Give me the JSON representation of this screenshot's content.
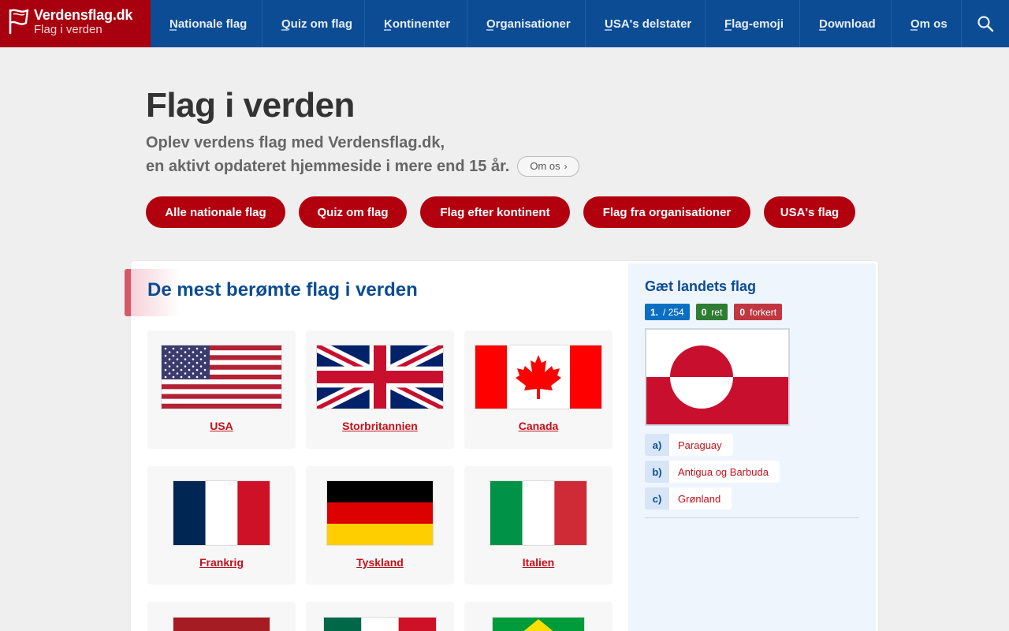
{
  "brand": {
    "title": "Verdensflag.dk",
    "subtitle": "Flag i verden",
    "icon": "flag-outline-icon"
  },
  "nav": {
    "items": [
      {
        "label": "Nationale flag"
      },
      {
        "label": "Quiz om flag"
      },
      {
        "label": "Kontinenter"
      },
      {
        "label": "Organisationer"
      },
      {
        "label": "USA's delstater"
      },
      {
        "label": "Flag-emoji"
      },
      {
        "label": "Download"
      },
      {
        "label": "Om os"
      }
    ],
    "search_icon": "search-icon"
  },
  "hero": {
    "title": "Flag i verden",
    "line1": "Oplev verdens flag med Verdensflag.dk,",
    "line2": "en aktivt opdateret hjemmeside i mere end 15 år.",
    "about_label": "Om os"
  },
  "pills": [
    {
      "label": "Alle nationale flag"
    },
    {
      "label": "Quiz om flag"
    },
    {
      "label": "Flag efter kontinent"
    },
    {
      "label": "Flag fra organisationer"
    },
    {
      "label": "USA's flag"
    }
  ],
  "famous": {
    "title": "De mest berømte flag i verden",
    "flags": [
      {
        "name": "USA"
      },
      {
        "name": "Storbritannien"
      },
      {
        "name": "Canada"
      },
      {
        "name": "Frankrig"
      },
      {
        "name": "Tyskland"
      },
      {
        "name": "Italien"
      }
    ]
  },
  "quiz": {
    "title": "Gæt landets flag",
    "progress_current": "1.",
    "progress_total": "/ 254",
    "correct_count": "0",
    "correct_label": "ret",
    "wrong_count": "0",
    "wrong_label": "forkert",
    "options": [
      {
        "letter": "a)",
        "text": "Paraguay"
      },
      {
        "letter": "b)",
        "text": "Antigua og Barbuda"
      },
      {
        "letter": "c)",
        "text": "Grønland"
      }
    ]
  },
  "colors": {
    "nav_blue": "#0c4c94",
    "brand_red": "#a8000f",
    "pill_red": "#b3000e",
    "link_red": "#c41019"
  }
}
